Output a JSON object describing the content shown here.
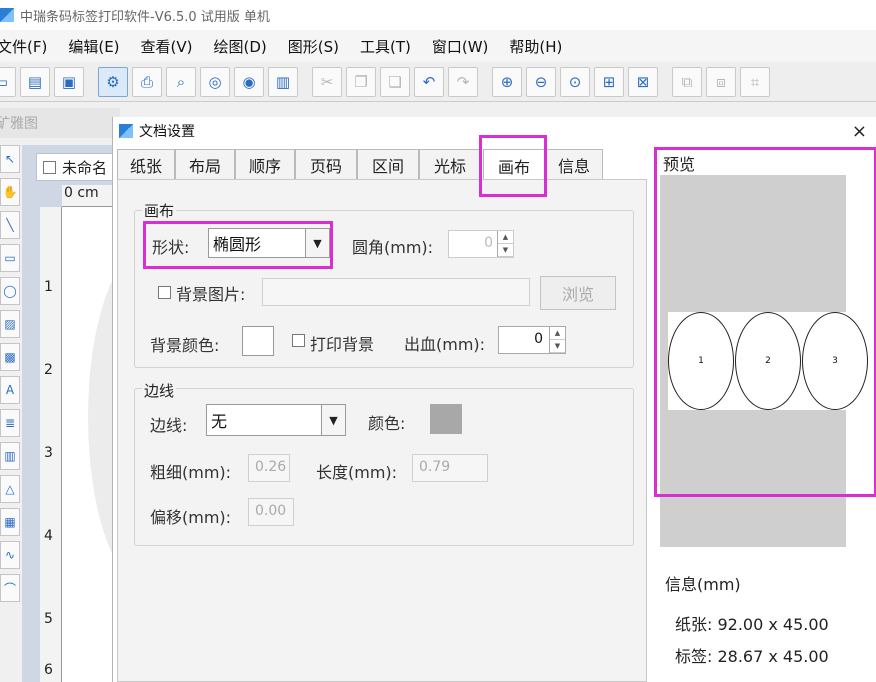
{
  "app": {
    "title": "中瑞条码标签打印软件-V6.5.0 试用版 单机"
  },
  "menu": [
    "文件(F)",
    "编辑(E)",
    "查看(V)",
    "绘图(D)",
    "图形(S)",
    "工具(T)",
    "窗口(W)",
    "帮助(H)"
  ],
  "toolbar_icons": [
    "new-file-icon",
    "open-folder-icon",
    "save-icon",
    "settings-icon",
    "print-icon",
    "print-preview-icon",
    "database-icon",
    "database-settings-icon",
    "barcode-icon",
    "cut-icon",
    "copy-icon",
    "paste-icon",
    "undo-icon",
    "redo-icon",
    "zoom-in-icon",
    "zoom-out-icon",
    "zoom-fit-icon",
    "zoom-actual-icon",
    "fit-page-icon",
    "group-icon",
    "ungroup-icon",
    "align-icon"
  ],
  "doc_tab": {
    "label": "矿雅图"
  },
  "canvas": {
    "tab_label": "未命名",
    "ruler_top_label": "0 cm",
    "ruler_numbers": [
      "1",
      "2",
      "3",
      "4",
      "5",
      "6"
    ]
  },
  "dialog": {
    "title": "文档设置",
    "close_glyph": "×",
    "tabs": [
      "纸张",
      "布局",
      "顺序",
      "页码",
      "区间",
      "光标",
      "画布",
      "信息"
    ],
    "active_tab": "画布",
    "canvas_group": {
      "title": "画布",
      "shape_label": "形状:",
      "shape_value": "椭圆形",
      "corner_label": "圆角(mm):",
      "corner_value": "0",
      "bg_image_label": "背景图片:",
      "browse_button": "浏览",
      "bg_color_label": "背景颜色:",
      "print_bg_label": "打印背景",
      "bleed_label": "出血(mm):",
      "bleed_value": "0"
    },
    "border_group": {
      "title": "边线",
      "border_label": "边线:",
      "border_value": "无",
      "color_label": "颜色:",
      "thickness_label": "粗细(mm):",
      "thickness_value": "0.26",
      "length_label": "长度(mm):",
      "length_value": "0.79",
      "offset_label": "偏移(mm):",
      "offset_value": "0.00"
    },
    "preview": {
      "title": "预览",
      "labels": [
        "1",
        "2",
        "3"
      ]
    },
    "info": {
      "title": "信息(mm)",
      "paper": "纸张: 92.00 x 45.00",
      "label": "标签: 28.67 x 45.00"
    }
  },
  "colors": {
    "highlight": "#d92ed1",
    "border_color_swatch": "#a8a8a8",
    "bg_color_swatch": "#ffffff"
  }
}
